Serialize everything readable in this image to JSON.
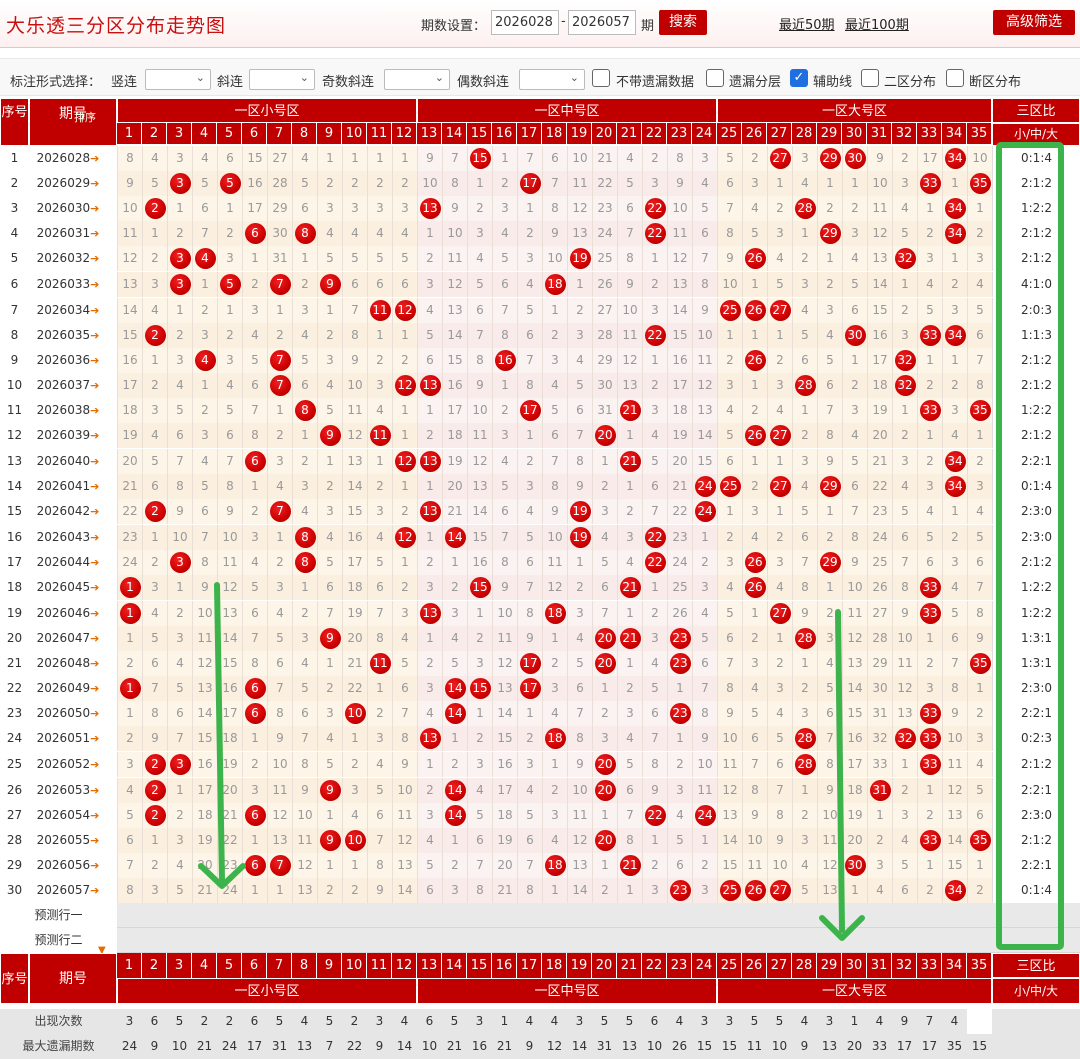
{
  "header": {
    "title": "大乐透三分区分布走势图",
    "period_label": "期数设置：",
    "from": "2026028",
    "sep": "-",
    "to": "2026057",
    "period_suffix": "期",
    "search": "搜索",
    "link50": "最近50期",
    "link100": "最近100期",
    "advanced": "高级筛选"
  },
  "options": {
    "label": "标注形式选择：",
    "shulian": "竖连",
    "xielian": "斜连",
    "jishu": "奇数斜连",
    "oushu": "偶数斜连",
    "cb1": "不带遗漏数据",
    "cb2": "遗漏分层",
    "cb3": "辅助线",
    "cb4": "二区分布",
    "cb5": "断区分布"
  },
  "table": {
    "h_seq": "序号",
    "h_period": "期号",
    "h_sort": "排序",
    "zone1": "一区小号区",
    "zone2": "一区中号区",
    "zone3": "一区大号区",
    "ratio_head": "三区比",
    "ratio_sub": "小/中/大",
    "pred1": "预测行一",
    "pred2": "预测行二",
    "stat1": "出现次数",
    "stat2": "最大遗漏期数"
  },
  "numbers": [
    "1",
    "2",
    "3",
    "4",
    "5",
    "6",
    "7",
    "8",
    "9",
    "10",
    "11",
    "12",
    "13",
    "14",
    "15",
    "16",
    "17",
    "18",
    "19",
    "20",
    "21",
    "22",
    "23",
    "24",
    "25",
    "26",
    "27",
    "28",
    "29",
    "30",
    "31",
    "32",
    "33",
    "34",
    "35"
  ],
  "rows": [
    {
      "seq": "1",
      "period": "2026028",
      "cells": [
        8,
        4,
        3,
        4,
        6,
        15,
        27,
        4,
        1,
        1,
        1,
        1,
        9,
        7,
        "15",
        1,
        7,
        6,
        10,
        21,
        4,
        2,
        8,
        3,
        5,
        2,
        "27",
        3,
        "29",
        "30",
        9,
        2,
        17,
        "34",
        10
      ],
      "ratio": "0:1:4"
    },
    {
      "seq": "2",
      "period": "2026029",
      "cells": [
        9,
        5,
        "3",
        5,
        "5",
        16,
        28,
        5,
        2,
        2,
        2,
        2,
        10,
        8,
        1,
        2,
        "17",
        7,
        11,
        22,
        5,
        3,
        9,
        4,
        6,
        3,
        1,
        4,
        1,
        1,
        10,
        3,
        "33",
        1,
        "35"
      ],
      "ratio": "2:1:2"
    },
    {
      "seq": "3",
      "period": "2026030",
      "cells": [
        10,
        "2",
        1,
        6,
        1,
        17,
        29,
        6,
        3,
        3,
        3,
        3,
        "13",
        9,
        2,
        3,
        1,
        8,
        12,
        23,
        6,
        "22",
        10,
        5,
        7,
        4,
        2,
        "28",
        2,
        2,
        11,
        4,
        1,
        "34",
        1
      ],
      "ratio": "1:2:2"
    },
    {
      "seq": "4",
      "period": "2026031",
      "cells": [
        11,
        1,
        2,
        7,
        2,
        "6",
        30,
        "8",
        4,
        4,
        4,
        4,
        1,
        10,
        3,
        4,
        2,
        9,
        13,
        24,
        7,
        "22",
        11,
        6,
        8,
        5,
        3,
        1,
        "29",
        3,
        12,
        5,
        2,
        "34",
        2
      ],
      "ratio": "2:1:2"
    },
    {
      "seq": "5",
      "period": "2026032",
      "cells": [
        12,
        2,
        "3",
        "4",
        3,
        1,
        31,
        1,
        5,
        5,
        5,
        5,
        2,
        11,
        4,
        5,
        3,
        10,
        "19",
        25,
        8,
        1,
        12,
        7,
        9,
        "26",
        4,
        2,
        1,
        4,
        13,
        "32",
        3,
        1,
        3
      ],
      "ratio": "2:1:2"
    },
    {
      "seq": "6",
      "period": "2026033",
      "cells": [
        13,
        3,
        "3",
        1,
        "5",
        2,
        "7",
        2,
        "9",
        6,
        6,
        6,
        3,
        12,
        5,
        6,
        4,
        "18",
        1,
        26,
        9,
        2,
        13,
        8,
        10,
        1,
        5,
        3,
        2,
        5,
        14,
        1,
        4,
        2,
        4
      ],
      "ratio": "4:1:0"
    },
    {
      "seq": "7",
      "period": "2026034",
      "cells": [
        14,
        4,
        1,
        2,
        1,
        3,
        1,
        3,
        1,
        7,
        "11",
        "12",
        4,
        13,
        6,
        7,
        5,
        1,
        2,
        27,
        10,
        3,
        14,
        9,
        "25",
        "26",
        "27",
        4,
        3,
        6,
        15,
        2,
        5,
        3,
        5
      ],
      "ratio": "2:0:3"
    },
    {
      "seq": "8",
      "period": "2026035",
      "cells": [
        15,
        "2",
        2,
        3,
        2,
        4,
        2,
        4,
        2,
        8,
        1,
        1,
        5,
        14,
        7,
        8,
        6,
        2,
        3,
        28,
        11,
        "22",
        15,
        10,
        1,
        1,
        1,
        5,
        4,
        "30",
        16,
        3,
        "33",
        "34",
        6
      ],
      "ratio": "1:1:3"
    },
    {
      "seq": "9",
      "period": "2026036",
      "cells": [
        16,
        1,
        3,
        "4",
        3,
        5,
        "7",
        5,
        3,
        9,
        2,
        2,
        6,
        15,
        8,
        "16",
        7,
        3,
        4,
        29,
        12,
        1,
        16,
        11,
        2,
        "26",
        2,
        6,
        5,
        1,
        17,
        "32",
        1,
        1,
        7
      ],
      "ratio": "2:1:2"
    },
    {
      "seq": "10",
      "period": "2026037",
      "cells": [
        17,
        2,
        4,
        1,
        4,
        6,
        "7",
        6,
        4,
        10,
        3,
        "12",
        "13",
        16,
        9,
        1,
        8,
        4,
        5,
        30,
        13,
        2,
        17,
        12,
        3,
        1,
        3,
        "28",
        6,
        2,
        18,
        "32",
        2,
        2,
        8
      ],
      "ratio": "2:1:2"
    },
    {
      "seq": "11",
      "period": "2026038",
      "cells": [
        18,
        3,
        5,
        2,
        5,
        7,
        1,
        "8",
        5,
        11,
        4,
        1,
        1,
        17,
        10,
        2,
        "17",
        5,
        6,
        31,
        "21",
        3,
        18,
        13,
        4,
        2,
        4,
        1,
        7,
        3,
        19,
        1,
        "33",
        3,
        "35"
      ],
      "ratio": "1:2:2"
    },
    {
      "seq": "12",
      "period": "2026039",
      "cells": [
        19,
        4,
        6,
        3,
        6,
        8,
        2,
        1,
        "9",
        12,
        "11",
        1,
        2,
        18,
        11,
        3,
        1,
        6,
        7,
        "20",
        1,
        4,
        19,
        14,
        5,
        "26",
        "27",
        2,
        8,
        4,
        20,
        2,
        1,
        4,
        1
      ],
      "ratio": "2:1:2"
    },
    {
      "seq": "13",
      "period": "2026040",
      "cells": [
        20,
        5,
        7,
        4,
        7,
        "6",
        3,
        2,
        1,
        13,
        1,
        "12",
        "13",
        19,
        12,
        4,
        2,
        7,
        8,
        1,
        "21",
        5,
        20,
        15,
        6,
        1,
        1,
        3,
        9,
        5,
        21,
        3,
        2,
        "34",
        2
      ],
      "ratio": "2:2:1"
    },
    {
      "seq": "14",
      "period": "2026041",
      "cells": [
        21,
        6,
        8,
        5,
        8,
        1,
        4,
        3,
        2,
        14,
        2,
        1,
        1,
        20,
        13,
        5,
        3,
        8,
        9,
        2,
        1,
        6,
        21,
        "24",
        "25",
        2,
        "27",
        4,
        "29",
        6,
        22,
        4,
        3,
        "34",
        3
      ],
      "ratio": "0:1:4"
    },
    {
      "seq": "15",
      "period": "2026042",
      "cells": [
        22,
        "2",
        9,
        6,
        9,
        2,
        "7",
        4,
        3,
        15,
        3,
        2,
        "13",
        21,
        14,
        6,
        4,
        9,
        "19",
        3,
        2,
        7,
        22,
        "24",
        1,
        3,
        1,
        5,
        1,
        7,
        23,
        5,
        4,
        1,
        4
      ],
      "ratio": "2:3:0"
    },
    {
      "seq": "16",
      "period": "2026043",
      "cells": [
        23,
        1,
        10,
        7,
        10,
        3,
        1,
        "8",
        4,
        16,
        4,
        "12",
        1,
        "14",
        15,
        7,
        5,
        10,
        "19",
        4,
        3,
        "22",
        23,
        1,
        2,
        4,
        2,
        6,
        2,
        8,
        24,
        6,
        5,
        2,
        5
      ],
      "ratio": "2:3:0"
    },
    {
      "seq": "17",
      "period": "2026044",
      "cells": [
        24,
        2,
        "3",
        8,
        11,
        4,
        2,
        "8",
        5,
        17,
        5,
        1,
        2,
        1,
        16,
        8,
        6,
        11,
        1,
        5,
        4,
        "22",
        24,
        2,
        3,
        "26",
        3,
        7,
        "29",
        9,
        25,
        7,
        6,
        3,
        6
      ],
      "ratio": "2:1:2"
    },
    {
      "seq": "18",
      "period": "2026045",
      "cells": [
        "1",
        3,
        1,
        9,
        12,
        5,
        3,
        1,
        6,
        18,
        6,
        2,
        3,
        2,
        "15",
        9,
        7,
        12,
        2,
        6,
        "21",
        1,
        25,
        3,
        4,
        "26",
        4,
        8,
        1,
        10,
        26,
        8,
        "33",
        4,
        7
      ],
      "ratio": "1:2:2"
    },
    {
      "seq": "19",
      "period": "2026046",
      "cells": [
        "1",
        4,
        2,
        10,
        13,
        6,
        4,
        2,
        7,
        19,
        7,
        3,
        "13",
        3,
        1,
        10,
        8,
        "18",
        3,
        7,
        1,
        2,
        26,
        4,
        5,
        1,
        "27",
        9,
        2,
        11,
        27,
        9,
        "33",
        5,
        8
      ],
      "ratio": "1:2:2"
    },
    {
      "seq": "20",
      "period": "2026047",
      "cells": [
        1,
        5,
        3,
        11,
        14,
        7,
        5,
        3,
        "9",
        20,
        8,
        4,
        1,
        4,
        2,
        11,
        9,
        1,
        4,
        "20",
        "21",
        3,
        "23",
        5,
        6,
        2,
        1,
        "28",
        3,
        12,
        28,
        10,
        1,
        6,
        9
      ],
      "ratio": "1:3:1"
    },
    {
      "seq": "21",
      "period": "2026048",
      "cells": [
        2,
        6,
        4,
        12,
        15,
        8,
        6,
        4,
        1,
        21,
        "11",
        5,
        2,
        5,
        3,
        12,
        "17",
        2,
        5,
        "20",
        1,
        4,
        "23",
        6,
        7,
        3,
        2,
        1,
        4,
        13,
        29,
        11,
        2,
        7,
        "35"
      ],
      "ratio": "1:3:1"
    },
    {
      "seq": "22",
      "period": "2026049",
      "cells": [
        "1",
        7,
        5,
        13,
        16,
        "6",
        7,
        5,
        2,
        22,
        1,
        6,
        3,
        "14",
        "15",
        13,
        "17",
        3,
        6,
        1,
        2,
        5,
        1,
        7,
        8,
        4,
        3,
        2,
        5,
        14,
        30,
        12,
        3,
        8,
        1
      ],
      "ratio": "2:3:0"
    },
    {
      "seq": "23",
      "period": "2026050",
      "cells": [
        1,
        8,
        6,
        14,
        17,
        "6",
        8,
        6,
        3,
        "10",
        2,
        7,
        4,
        "14",
        1,
        14,
        1,
        4,
        7,
        2,
        3,
        6,
        "23",
        8,
        9,
        5,
        4,
        3,
        6,
        15,
        31,
        13,
        "33",
        9,
        2
      ],
      "ratio": "2:2:1"
    },
    {
      "seq": "24",
      "period": "2026051",
      "cells": [
        2,
        9,
        7,
        15,
        18,
        1,
        9,
        7,
        4,
        1,
        3,
        8,
        "13",
        1,
        2,
        15,
        2,
        "18",
        8,
        3,
        4,
        7,
        1,
        9,
        10,
        6,
        5,
        "28",
        7,
        16,
        32,
        "32",
        "33",
        10,
        3
      ],
      "ratio": "0:2:3"
    },
    {
      "seq": "25",
      "period": "2026052",
      "cells": [
        3,
        "2",
        "3",
        16,
        19,
        2,
        10,
        8,
        5,
        2,
        4,
        9,
        1,
        2,
        3,
        16,
        3,
        1,
        9,
        "20",
        5,
        8,
        2,
        10,
        11,
        7,
        6,
        "28",
        8,
        17,
        33,
        1,
        "33",
        11,
        4
      ],
      "ratio": "2:1:2"
    },
    {
      "seq": "26",
      "period": "2026053",
      "cells": [
        4,
        "2",
        1,
        17,
        20,
        3,
        11,
        9,
        "9",
        3,
        5,
        10,
        2,
        "14",
        4,
        17,
        4,
        2,
        10,
        "20",
        6,
        9,
        3,
        11,
        12,
        8,
        7,
        1,
        9,
        18,
        "31",
        2,
        1,
        12,
        5
      ],
      "ratio": "2:2:1"
    },
    {
      "seq": "27",
      "period": "2026054",
      "cells": [
        5,
        "2",
        2,
        18,
        21,
        "6",
        12,
        10,
        1,
        4,
        6,
        11,
        3,
        "14",
        5,
        18,
        5,
        3,
        11,
        1,
        7,
        "22",
        4,
        "24",
        13,
        9,
        8,
        2,
        10,
        19,
        1,
        3,
        2,
        13,
        6
      ],
      "ratio": "2:3:0"
    },
    {
      "seq": "28",
      "period": "2026055",
      "cells": [
        6,
        1,
        3,
        19,
        22,
        1,
        13,
        11,
        "9",
        "10",
        7,
        12,
        4,
        1,
        6,
        19,
        6,
        4,
        12,
        "20",
        8,
        1,
        5,
        1,
        14,
        10,
        9,
        3,
        11,
        20,
        2,
        4,
        "33",
        14,
        "35"
      ],
      "ratio": "2:1:2"
    },
    {
      "seq": "29",
      "period": "2026056",
      "cells": [
        7,
        2,
        4,
        20,
        23,
        "6",
        "7",
        12,
        1,
        1,
        8,
        13,
        5,
        2,
        7,
        20,
        7,
        "18",
        13,
        1,
        "21",
        2,
        6,
        2,
        15,
        11,
        10,
        4,
        12,
        "30",
        3,
        5,
        1,
        15,
        1
      ],
      "ratio": "2:2:1"
    },
    {
      "seq": "30",
      "period": "2026057",
      "cells": [
        8,
        3,
        5,
        21,
        24,
        1,
        1,
        13,
        2,
        2,
        9,
        14,
        6,
        3,
        8,
        21,
        8,
        1,
        14,
        2,
        1,
        3,
        "23",
        3,
        "25",
        "26",
        "27",
        5,
        13,
        1,
        4,
        6,
        2,
        "34",
        2
      ],
      "ratio": "0:1:4"
    }
  ],
  "stats": {
    "appear": [
      3,
      6,
      5,
      2,
      2,
      6,
      5,
      4,
      5,
      2,
      3,
      4,
      6,
      5,
      3,
      1,
      4,
      4,
      3,
      5,
      5,
      6,
      4,
      3,
      3,
      5,
      5,
      4,
      3,
      1,
      4,
      9,
      7,
      4
    ],
    "maxmiss": [
      24,
      9,
      10,
      21,
      24,
      17,
      31,
      13,
      7,
      22,
      9,
      14,
      10,
      21,
      16,
      21,
      9,
      12,
      14,
      31,
      13,
      10,
      26,
      15,
      15,
      11,
      10,
      9,
      13,
      20,
      33,
      17,
      17,
      35,
      15
    ]
  },
  "colors": {
    "brand_red": "#c00000",
    "zebra1": "#fdf7f0",
    "zebra2": "#fbece6",
    "ball": "#cc0000",
    "helper_green": "#3cb44b",
    "ratio_highlight": "#3cb44b"
  }
}
